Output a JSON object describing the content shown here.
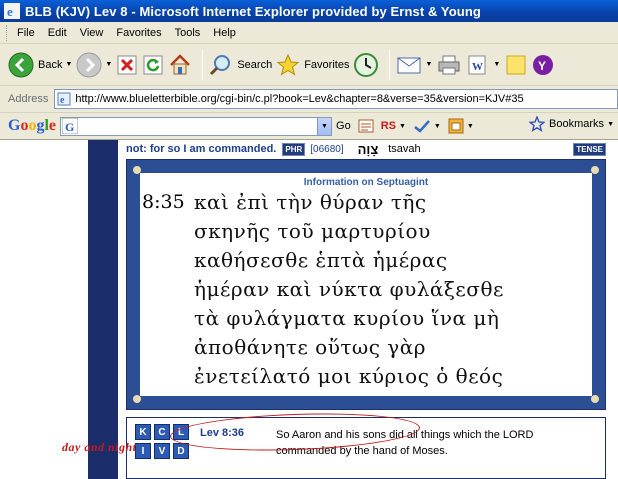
{
  "window": {
    "title": "BLB (KJV) Lev 8 - Microsoft Internet Explorer provided by Ernst & Young"
  },
  "menu": [
    "File",
    "Edit",
    "View",
    "Favorites",
    "Tools",
    "Help"
  ],
  "toolbar": {
    "back": "Back",
    "search": "Search",
    "favorites": "Favorites"
  },
  "address": {
    "label": "Address",
    "url": "http://www.blueletterbible.org/cgi-bin/c.pl?book=Lev&chapter=8&verse=35&version=KJV#35"
  },
  "googlebar": {
    "logo": "Google",
    "go": "Go",
    "rs": "RS",
    "bookmarks": "Bookmarks"
  },
  "top_row": {
    "text": "not: for so I am commanded.",
    "badge1": "PHR",
    "strongs": "[06680]",
    "hebrew": "צָוָה",
    "translit": "tsavah",
    "tense": "TENSE"
  },
  "septuagint": {
    "title": "Information on Septuagint",
    "verse_num": "8:35",
    "lines": [
      "καὶ ἐπὶ τὴν θύραν τῆς",
      "σκηνῆς τοῦ μαρτυρίου",
      "καθήσεσθε ἑπτὰ ἡμέρας",
      "ἡμέραν καὶ νύκτα φυλάξεσθε",
      "τὰ φυλάγματα κυρίου ἵνα μὴ",
      "ἀποθάνητε οὕτως γὰρ",
      "ἐνετείλατό μοι κύριος ὁ θεός"
    ]
  },
  "annotation": "day and night",
  "next_verse": {
    "letters": [
      "K",
      "C",
      "L",
      "I",
      "V",
      "D"
    ],
    "ref": "Lev 8:36",
    "text": "So Aaron and his sons did all things which the LORD commanded by the hand of Moses."
  }
}
